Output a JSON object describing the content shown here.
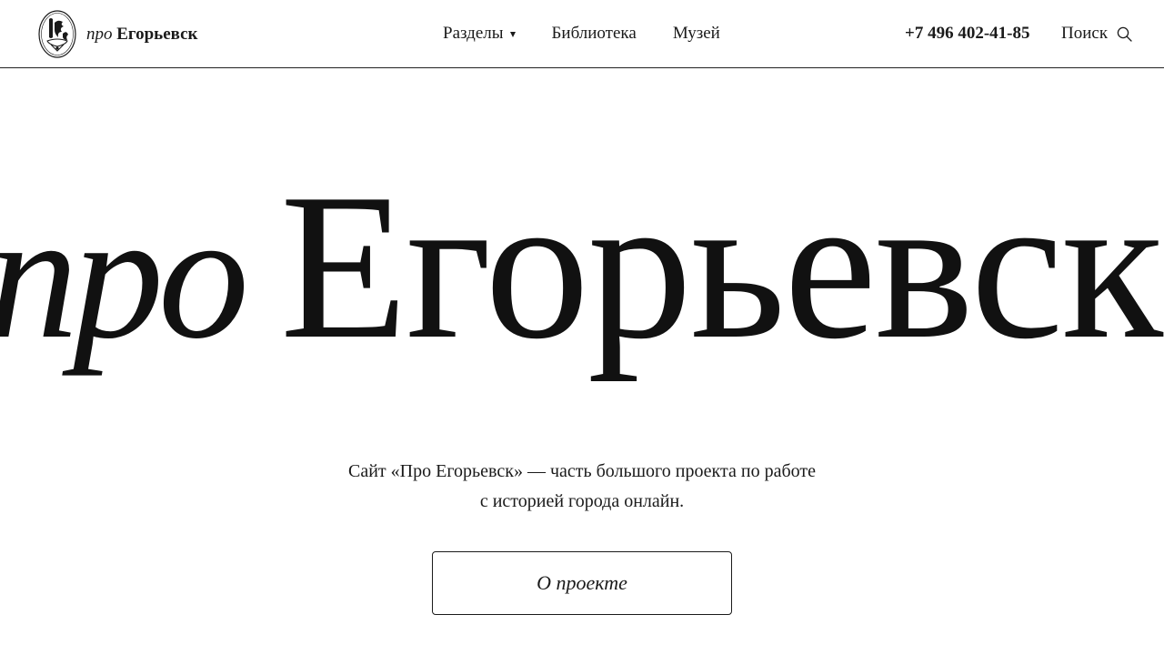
{
  "header": {
    "logo": {
      "emblem_icon": "city-crest-emblem-icon",
      "prefix": "про",
      "name": "Егорьевск"
    },
    "nav": {
      "items": [
        {
          "label": "Разделы",
          "has_dropdown": true,
          "icon": "caret-down-icon"
        },
        {
          "label": "Библиотека"
        },
        {
          "label": "Музей"
        }
      ]
    },
    "phone": "+7 496 402-41-85",
    "search": {
      "label": "Поиск",
      "icon": "search-icon"
    }
  },
  "hero": {
    "title_prefix": "про",
    "title_name": "Егорьевск",
    "lead_line1": "Сайт «Про Егорьевск» — часть большого проекта по работе",
    "lead_line2": "с историей города онлайн.",
    "button_label": "О проекте"
  },
  "colors": {
    "background": "#ffffff",
    "text": "#1a1a1a",
    "border": "#222222"
  }
}
